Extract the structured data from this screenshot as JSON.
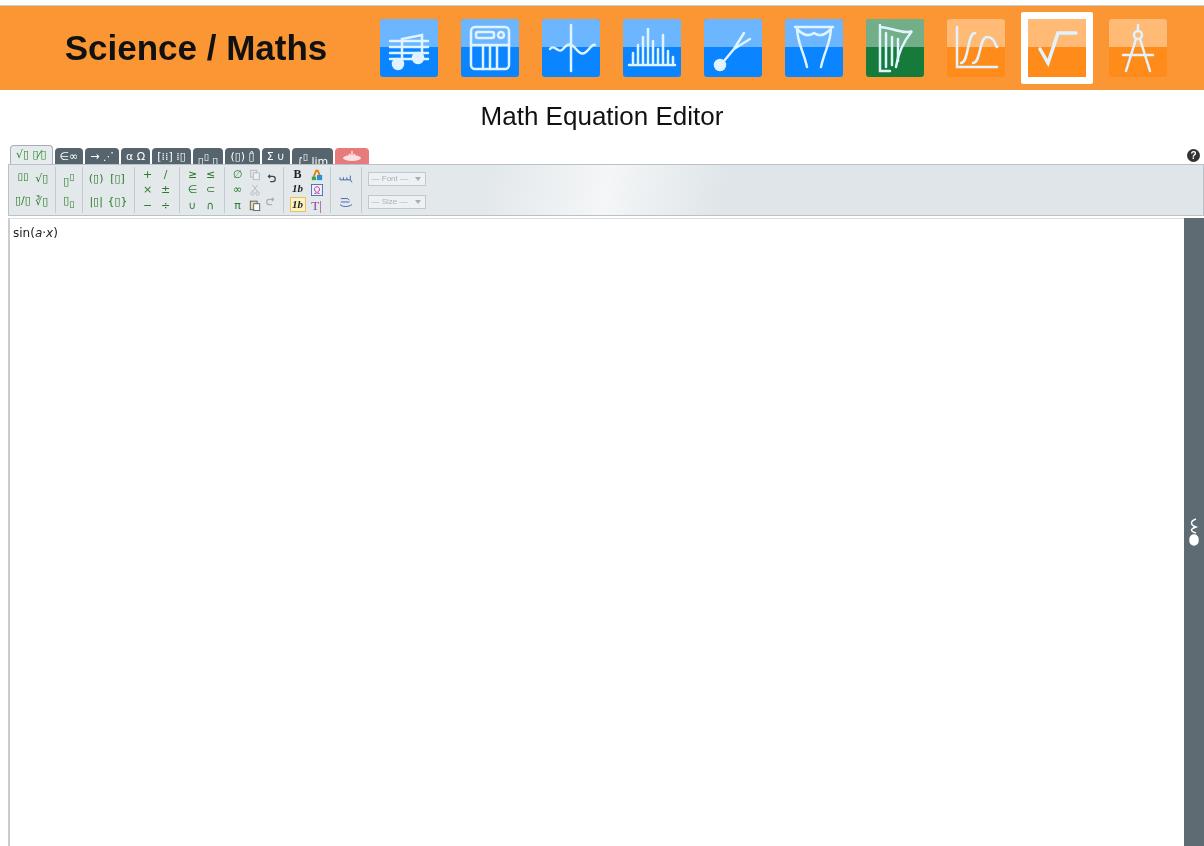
{
  "header": {
    "title": "Science / Maths",
    "apps": [
      {
        "color": "#0a84ff",
        "selected": false
      },
      {
        "color": "#0a84ff",
        "selected": false
      },
      {
        "color": "#0a84ff",
        "selected": false
      },
      {
        "color": "#0a84ff",
        "selected": false
      },
      {
        "color": "#0a84ff",
        "selected": false
      },
      {
        "color": "#0a84ff",
        "selected": false
      },
      {
        "color": "#157a3a",
        "selected": false
      },
      {
        "color": "#ff8c1a",
        "selected": false
      },
      {
        "color": "#ff8c1a",
        "selected": true
      },
      {
        "color": "#ff8c1a",
        "selected": false
      }
    ]
  },
  "page_title": "Math Equation Editor",
  "tabs": [
    {
      "label": "√▯ ▯⁄▯",
      "selected": true,
      "kind": "text"
    },
    {
      "label": "∈∞",
      "selected": false,
      "kind": "text"
    },
    {
      "label": "→ ⋰",
      "selected": false,
      "kind": "text"
    },
    {
      "label": "α Ω",
      "selected": false,
      "kind": "text"
    },
    {
      "label": "[⁞⁞] ⁞▯",
      "selected": false,
      "kind": "text"
    },
    {
      "label": "▯$^{▯}$ ▯",
      "selected": false,
      "kind": "text"
    },
    {
      "label": "(▯) ▯̂",
      "selected": false,
      "kind": "text"
    },
    {
      "label": "Σ ∪",
      "selected": false,
      "kind": "text"
    },
    {
      "label": "∫$^{▯}$ lim",
      "selected": false,
      "kind": "text"
    },
    {
      "selected": false,
      "kind": "red"
    }
  ],
  "help": "?",
  "toolbar": [
    {
      "columns": [
        [
          {
            "kind": "stack",
            "label": "▯▯"
          },
          {
            "kind": "text",
            "label": "▯/▯"
          }
        ],
        [
          {
            "kind": "text",
            "label": "√▯"
          },
          {
            "kind": "text",
            "label": "∛▯"
          }
        ]
      ]
    },
    {
      "columns": [
        [
          {
            "kind": "text",
            "label": "▯$^{▯}$"
          },
          {
            "kind": "text",
            "label": "▯$_{▯}$"
          }
        ]
      ]
    },
    {
      "columns": [
        [
          {
            "kind": "text",
            "label": "(▯)"
          },
          {
            "kind": "text",
            "label": "|▯|"
          }
        ],
        [
          {
            "kind": "text",
            "label": "[▯]"
          },
          {
            "kind": "text",
            "label": "{▯}"
          }
        ]
      ]
    },
    {
      "columns": [
        [
          {
            "kind": "text",
            "label": "+"
          },
          {
            "kind": "text",
            "label": "×"
          },
          {
            "kind": "text",
            "label": "−"
          }
        ],
        [
          {
            "kind": "text",
            "label": "/"
          },
          {
            "kind": "text",
            "label": "±"
          },
          {
            "kind": "text",
            "label": "÷"
          }
        ]
      ]
    },
    {
      "columns": [
        [
          {
            "kind": "text",
            "label": "≥"
          },
          {
            "kind": "text",
            "label": "∈"
          },
          {
            "kind": "text",
            "label": "∪"
          }
        ],
        [
          {
            "kind": "text",
            "label": "≤"
          },
          {
            "kind": "text",
            "label": "⊂"
          },
          {
            "kind": "text",
            "label": "∩"
          }
        ]
      ]
    },
    {
      "columns": [
        [
          {
            "kind": "text",
            "label": "∅"
          },
          {
            "kind": "text",
            "label": "∞"
          },
          {
            "kind": "text",
            "label": "π"
          }
        ],
        [
          {
            "kind": "copy",
            "disabled": true
          },
          {
            "kind": "cut",
            "disabled": true
          },
          {
            "kind": "paste",
            "disabled": false
          }
        ],
        [
          {
            "kind": "undo",
            "disabled": false
          },
          {
            "kind": "redo",
            "disabled": true
          }
        ]
      ]
    },
    {
      "columns": [
        [
          {
            "kind": "bold",
            "label": "B",
            "selected": false
          },
          {
            "kind": "italic",
            "label": "1b",
            "selected": false
          },
          {
            "kind": "italic",
            "label": "1b",
            "selected": true
          }
        ],
        [
          {
            "kind": "color"
          },
          {
            "kind": "symbol"
          },
          {
            "kind": "serif",
            "label": "T|"
          }
        ]
      ]
    },
    {
      "columns": [
        [
          {
            "kind": "rtl"
          },
          {
            "kind": "ltr"
          }
        ]
      ]
    },
    {
      "columns": [
        [
          {
            "kind": "select",
            "label": "— Font —",
            "disabled": true
          },
          {
            "kind": "select",
            "label": "— Size —",
            "disabled": true
          }
        ]
      ]
    }
  ],
  "editor": {
    "content": "sin(*a*·*x*)"
  }
}
